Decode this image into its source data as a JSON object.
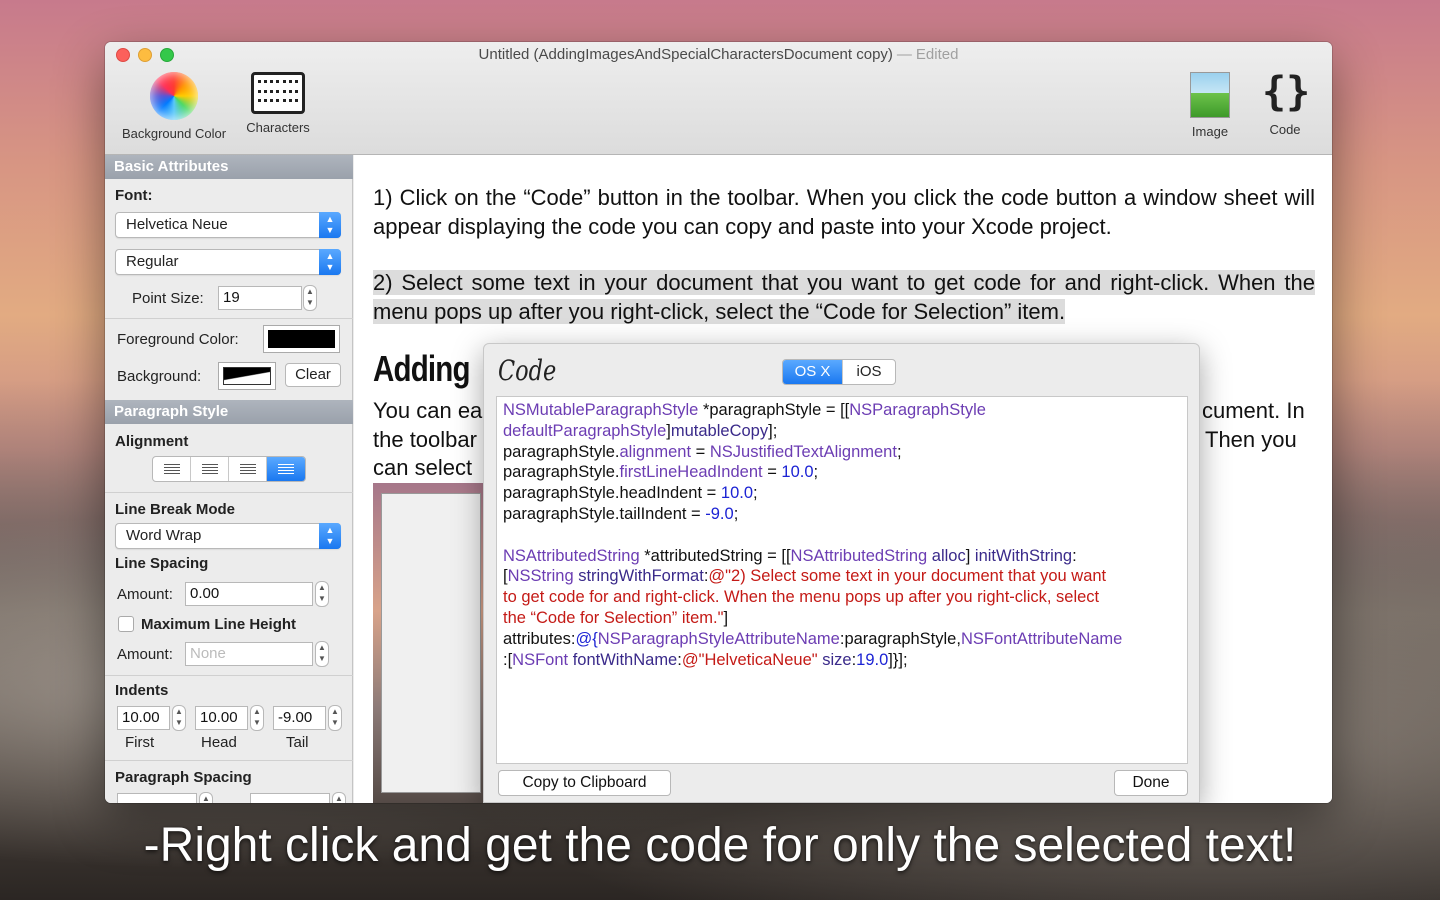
{
  "window": {
    "title": "Untitled (AddingImagesAndSpecialCharactersDocument copy)",
    "title_separator": "—",
    "edited_label": "Edited"
  },
  "toolbar": {
    "background_color_label": "Background Color",
    "characters_label": "Characters",
    "image_label": "Image",
    "code_label": "Code",
    "code_glyph": "{}"
  },
  "sidebar": {
    "basic_attributes": {
      "header": "Basic Attributes",
      "font_label": "Font:",
      "font_family": "Helvetica Neue",
      "font_style": "Regular",
      "point_size_label": "Point Size:",
      "point_size": "19",
      "foreground_label": "Foreground Color:",
      "foreground_color": "#000000",
      "background_label": "Background:",
      "clear_button": "Clear"
    },
    "paragraph_style": {
      "header": "Paragraph Style",
      "alignment_label": "Alignment",
      "alignment_options": [
        "left",
        "center",
        "right",
        "justify"
      ],
      "alignment_selected": "justify",
      "line_break_label": "Line Break Mode",
      "line_break_value": "Word Wrap",
      "line_spacing_label": "Line Spacing",
      "amount_label": "Amount:",
      "line_spacing_amount": "0.00",
      "max_line_height_label": "Maximum Line Height",
      "max_line_height_checked": false,
      "max_amount_label": "Amount:",
      "max_amount_placeholder": "None",
      "indents_label": "Indents",
      "indent_first": "10.00",
      "indent_head": "10.00",
      "indent_tail": "-9.00",
      "first_label": "First",
      "head_label": "Head",
      "tail_label": "Tail",
      "paragraph_spacing_label": "Paragraph Spacing"
    }
  },
  "document": {
    "para1": "1) Click on the “Code” button in the toolbar. When you click the code button a window sheet will appear displaying the code you can copy and paste into your Xcode project.",
    "para2": "2) Select some text in your document that you want to get code for and right-click. When the menu pops up after you right-click, select the “Code for Selection” item.",
    "heading": "Adding",
    "frag_line1_left": "You can ea",
    "frag_line2_left": "the toolbar",
    "frag_line3_left": "can select",
    "frag_line1_right": "cument. In",
    "frag_line2_right": "Then you"
  },
  "code_sheet": {
    "title": "Code",
    "platform_osx": "OS X",
    "platform_ios": "iOS",
    "platform_selected": "OS X",
    "copy_button": "Copy to Clipboard",
    "done_button": "Done",
    "lines": [
      [
        {
          "t": "NSMutableParagraphStyle",
          "c": "type"
        },
        {
          "t": " *paragraphStyle = [[",
          "c": "plain"
        },
        {
          "t": "NSParagraphStyle",
          "c": "type"
        }
      ],
      [
        {
          "t": "defaultParagraphStyle",
          "c": "type"
        },
        {
          "t": "]",
          "c": "plain"
        },
        {
          "t": "mutableCopy",
          "c": "meth"
        },
        {
          "t": "];",
          "c": "plain"
        }
      ],
      [
        {
          "t": "paragraphStyle.",
          "c": "plain"
        },
        {
          "t": "alignment",
          "c": "type"
        },
        {
          "t": " = ",
          "c": "plain"
        },
        {
          "t": "NSJustifiedTextAlignment",
          "c": "type"
        },
        {
          "t": ";",
          "c": "plain"
        }
      ],
      [
        {
          "t": "paragraphStyle.",
          "c": "plain"
        },
        {
          "t": "firstLineHeadIndent",
          "c": "type"
        },
        {
          "t": " = ",
          "c": "plain"
        },
        {
          "t": "10.0",
          "c": "num"
        },
        {
          "t": ";",
          "c": "plain"
        }
      ],
      [
        {
          "t": "paragraphStyle.headIndent = ",
          "c": "plain"
        },
        {
          "t": "10.0",
          "c": "num"
        },
        {
          "t": ";",
          "c": "plain"
        }
      ],
      [
        {
          "t": "paragraphStyle.tailIndent = ",
          "c": "plain"
        },
        {
          "t": "-9.0",
          "c": "num"
        },
        {
          "t": ";",
          "c": "plain"
        }
      ],
      [
        {
          "t": "",
          "c": "plain"
        }
      ],
      [
        {
          "t": "NSAttributedString",
          "c": "type"
        },
        {
          "t": " *attributedString = [[",
          "c": "plain"
        },
        {
          "t": "NSAttributedString",
          "c": "type"
        },
        {
          "t": " ",
          "c": "plain"
        },
        {
          "t": "alloc",
          "c": "meth"
        },
        {
          "t": "] ",
          "c": "plain"
        },
        {
          "t": "initWithString",
          "c": "meth"
        },
        {
          "t": ":",
          "c": "plain"
        }
      ],
      [
        {
          "t": "[",
          "c": "plain"
        },
        {
          "t": "NSString",
          "c": "type"
        },
        {
          "t": " ",
          "c": "plain"
        },
        {
          "t": "stringWithFormat",
          "c": "meth"
        },
        {
          "t": ":",
          "c": "plain"
        },
        {
          "t": "@\"2) Select some text in your document that you want",
          "c": "str"
        }
      ],
      [
        {
          "t": "to get code for and right-click. When the menu pops up after you right-click, select",
          "c": "str"
        }
      ],
      [
        {
          "t": "the “Code for Selection” item.\"",
          "c": "str"
        },
        {
          "t": "]",
          "c": "plain"
        }
      ],
      [
        {
          "t": "attributes:",
          "c": "plain"
        },
        {
          "t": "@{",
          "c": "num"
        },
        {
          "t": "NSParagraphStyleAttributeName",
          "c": "type"
        },
        {
          "t": ":paragraphStyle,",
          "c": "plain"
        },
        {
          "t": "NSFontAttributeName",
          "c": "type"
        }
      ],
      [
        {
          "t": ":[",
          "c": "plain"
        },
        {
          "t": "NSFont",
          "c": "type"
        },
        {
          "t": " ",
          "c": "plain"
        },
        {
          "t": "fontWithName",
          "c": "meth"
        },
        {
          "t": ":",
          "c": "plain"
        },
        {
          "t": "@\"HelveticaNeue\"",
          "c": "str"
        },
        {
          "t": " ",
          "c": "plain"
        },
        {
          "t": "size",
          "c": "meth"
        },
        {
          "t": ":",
          "c": "plain"
        },
        {
          "t": "19.0",
          "c": "num"
        },
        {
          "t": "]}];",
          "c": "plain"
        }
      ]
    ]
  },
  "caption": "-Right click and get the code for only the selected text!"
}
